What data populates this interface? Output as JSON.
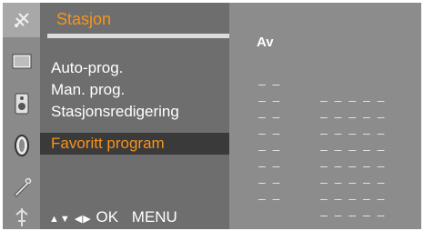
{
  "menu": {
    "title": "Stasjon",
    "items": [
      {
        "label": "Auto-prog."
      },
      {
        "label": "Man. prog."
      },
      {
        "label": "Stasjonsredigering"
      },
      {
        "label": "Favoritt program"
      }
    ],
    "nav_hint": {
      "arrows": "▲▼ ◀▶",
      "ok": "OK",
      "menu": "MENU"
    }
  },
  "icons": [
    "satellite-icon",
    "screen-icon",
    "sound-icon",
    "clock-icon",
    "tools-icon",
    "input-icon"
  ],
  "favorites": {
    "status": "Av",
    "slots": [
      {
        "number": "– –",
        "name": "– – – – –"
      },
      {
        "number": "– –",
        "name": "– – – – –"
      },
      {
        "number": "– –",
        "name": "– – – – –"
      },
      {
        "number": "– –",
        "name": "– – – – –"
      },
      {
        "number": "– –",
        "name": "– – – – –"
      },
      {
        "number": "– –",
        "name": "– – – – –"
      },
      {
        "number": "– –",
        "name": "– – – – –"
      },
      {
        "number": "– –",
        "name": "– – – – –"
      }
    ]
  },
  "colors": {
    "accent": "#f7941d",
    "panel": "#6e6e6e",
    "value_panel": "#8c8c8c"
  }
}
